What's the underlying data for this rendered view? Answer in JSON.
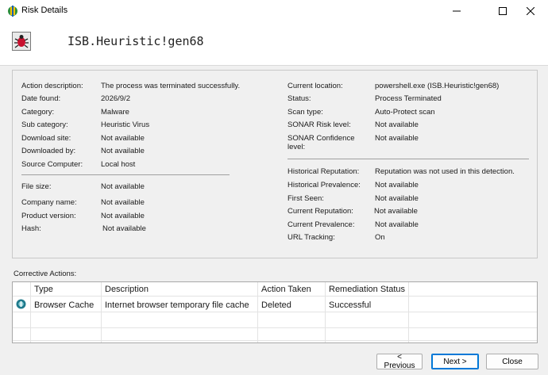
{
  "window": {
    "title": "Risk Details"
  },
  "header": {
    "risk_name": "ISB.Heuristic!gen68"
  },
  "left_details": [
    {
      "label": "Action description:",
      "value": "The process was terminated successfully."
    },
    {
      "label": "Date found:",
      "value": "2026/9/2"
    },
    {
      "label": "Category:",
      "value": "Malware"
    },
    {
      "label": "Sub category:",
      "value": "Heuristic Virus"
    },
    {
      "label": "Download site:",
      "value": "Not available"
    },
    {
      "label": "Downloaded by:",
      "value": "Not available"
    },
    {
      "label": "Source Computer:",
      "value": "Local host"
    }
  ],
  "left_details_2": [
    {
      "label": "File size:",
      "value": "Not available"
    },
    {
      "label": "Company name:",
      "value": "Not available"
    },
    {
      "label": "Product version:",
      "value": "Not available"
    },
    {
      "label": "Hash:",
      "value": "Not available"
    }
  ],
  "right_details": [
    {
      "label": "Current location:",
      "value": "powershell.exe (ISB.Heuristic!gen68)"
    },
    {
      "label": "Status:",
      "value": "Process Terminated"
    },
    {
      "label": "Scan type:",
      "value": "Auto-Protect scan"
    },
    {
      "label": "SONAR Risk level:",
      "value": "Not available"
    },
    {
      "label": "SONAR Confidence level:",
      "value": "Not available"
    }
  ],
  "right_details_2": [
    {
      "label": "Historical Reputation:",
      "value": "Reputation was not used in this detection."
    },
    {
      "label": "Historical Prevalence:",
      "value": "Not available"
    },
    {
      "label": "First Seen:",
      "value": "Not available"
    },
    {
      "label": "Current Reputation:",
      "value": "Not available"
    },
    {
      "label": "Current Prevalence:",
      "value": "Not available"
    },
    {
      "label": "URL Tracking:",
      "value": "On"
    }
  ],
  "corrective": {
    "label": "Corrective Actions:",
    "columns": [
      "Type",
      "Description",
      "Action Taken",
      "Remediation Status"
    ],
    "rows": [
      {
        "type": "Browser Cache",
        "description": "Internet browser temporary file cache",
        "action": "Deleted",
        "status": "Successful"
      }
    ]
  },
  "buttons": {
    "previous": "< Previous",
    "next": "Next >",
    "close": "Close"
  },
  "colors": {
    "risk_icon_red": "#c8102e",
    "info_icon_teal": "#1f7a8c",
    "default_button_border": "#0078d7"
  }
}
